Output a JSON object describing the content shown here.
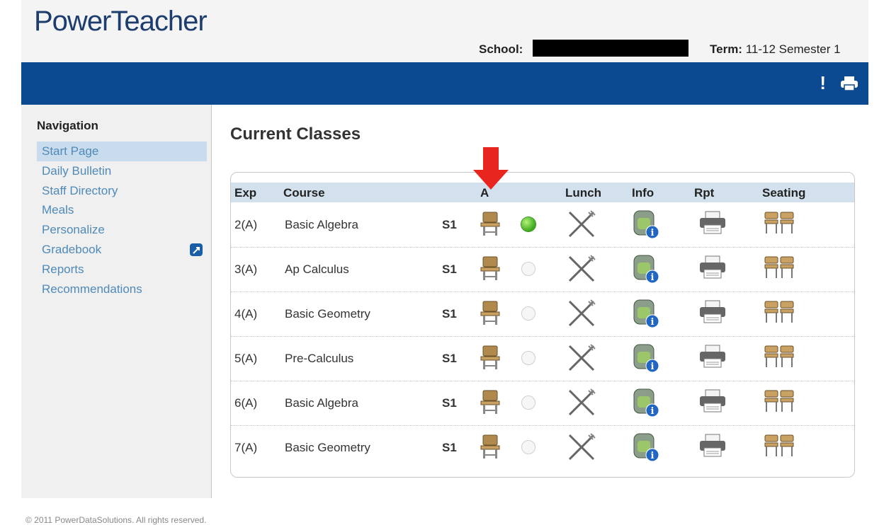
{
  "app": {
    "logo": "PowerTeacher"
  },
  "header": {
    "school_label": "School:",
    "term_label": "Term:",
    "term_value": "11-12 Semester 1",
    "alert_glyph": "!"
  },
  "nav": {
    "title": "Navigation",
    "items": [
      {
        "label": "Start Page"
      },
      {
        "label": "Daily Bulletin"
      },
      {
        "label": "Staff Directory"
      },
      {
        "label": "Meals"
      },
      {
        "label": "Personalize"
      },
      {
        "label": "Gradebook"
      },
      {
        "label": "Reports"
      },
      {
        "label": "Recommendations"
      }
    ]
  },
  "main": {
    "title": "Current Classes",
    "columns": {
      "exp": "Exp",
      "course": "Course",
      "attendance": "A",
      "lunch": "Lunch",
      "info": "Info",
      "rpt": "Rpt",
      "seating": "Seating"
    },
    "rows": [
      {
        "exp": "2(A)",
        "course": "Basic Algebra",
        "term": "S1",
        "attendance_done": true
      },
      {
        "exp": "3(A)",
        "course": "Ap Calculus",
        "term": "S1",
        "attendance_done": false
      },
      {
        "exp": "4(A)",
        "course": "Basic Geometry",
        "term": "S1",
        "attendance_done": false
      },
      {
        "exp": "5(A)",
        "course": "Pre-Calculus",
        "term": "S1",
        "attendance_done": false
      },
      {
        "exp": "6(A)",
        "course": "Basic Algebra",
        "term": "S1",
        "attendance_done": false
      },
      {
        "exp": "7(A)",
        "course": "Basic Geometry",
        "term": "S1",
        "attendance_done": false
      }
    ]
  },
  "footer": {
    "copyright": "© 2011 PowerDataSolutions. All rights reserved."
  },
  "colors": {
    "banner": "#0b4a91",
    "nav_link": "#4f8ab8",
    "arrow": "#e8251f",
    "status_on": "#3aa71b"
  }
}
